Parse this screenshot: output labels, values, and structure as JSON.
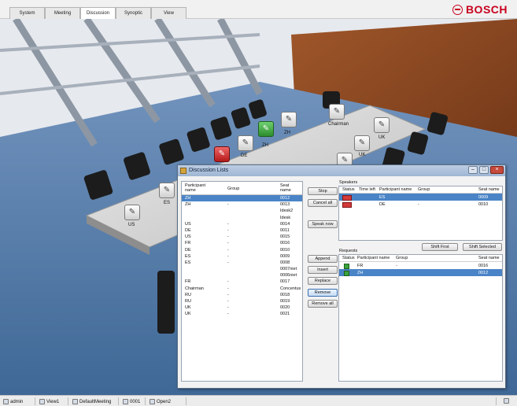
{
  "tabs": [
    "System",
    "Meeting",
    "Discussion",
    "Synoptic",
    "View"
  ],
  "active_tab": "Discussion",
  "brand": "BOSCH",
  "scene_seats": [
    {
      "label": "Chairman",
      "state": "normal"
    },
    {
      "label": "ZH",
      "state": "normal"
    },
    {
      "label": "ZH",
      "state": "green"
    },
    {
      "label": "DE",
      "state": "red"
    },
    {
      "label": "UK",
      "state": "normal"
    },
    {
      "label": "UK",
      "state": "normal"
    },
    {
      "label": "ES",
      "state": "normal"
    },
    {
      "label": "US",
      "state": "normal"
    }
  ],
  "dialog": {
    "title": "Discussion Lists",
    "participants": {
      "headers": [
        "Participant name",
        "Group",
        "Seat name"
      ],
      "rows": [
        [
          "ZH",
          "",
          "0012"
        ],
        [
          "ZH",
          "-",
          "0013"
        ],
        [
          "",
          "",
          "Idesk2"
        ],
        [
          "",
          "",
          "Idesk"
        ],
        [
          "US",
          "-",
          "0014"
        ],
        [
          "DE",
          "-",
          "0011"
        ],
        [
          "US",
          "-",
          "0015"
        ],
        [
          "FR",
          "-",
          "0016"
        ],
        [
          "DE",
          "-",
          "0010"
        ],
        [
          "ES",
          "-",
          "0009"
        ],
        [
          "ES",
          "-",
          "0008"
        ],
        [
          "",
          "",
          "0007niet"
        ],
        [
          "",
          "",
          "0006niet"
        ],
        [
          "FR",
          "-",
          "0017"
        ],
        [
          "Chairman",
          "-",
          "Concentus"
        ],
        [
          "RU",
          "-",
          "0018"
        ],
        [
          "RU",
          "-",
          "0019"
        ],
        [
          "UK",
          "-",
          "0020"
        ],
        [
          "UK",
          "-",
          "0021"
        ]
      ]
    },
    "buttons": {
      "stop": "Stop",
      "cancel_all": "Cancel all",
      "speak_now": "Speak now",
      "append": "Append",
      "insert": "Insert",
      "replace": "Replace",
      "remove": "Remove",
      "remove_all": "Remove all",
      "shift_first": "Shift First",
      "shift_selected": "Shift Selected"
    },
    "speakers": {
      "label": "Speakers",
      "headers": [
        "Status",
        "Time left",
        "Participant name",
        "Group",
        "Seat name"
      ],
      "rows": [
        {
          "participant": "ES",
          "group": "",
          "seat": "0009"
        },
        {
          "participant": "DE",
          "group": "-",
          "seat": "0010"
        }
      ]
    },
    "requests": {
      "label": "Requests",
      "headers": [
        "Status",
        "Participant name",
        "Group",
        "Seat name"
      ],
      "rows": [
        {
          "participant": "FR",
          "group": "-",
          "seat": "0016"
        },
        {
          "participant": "ZH",
          "group": "",
          "seat": "0012"
        }
      ]
    }
  },
  "statusbar": {
    "user": "admin",
    "view": "View1",
    "meeting": "DefaultMeeting",
    "seat": "0001",
    "mode": "Open2"
  }
}
